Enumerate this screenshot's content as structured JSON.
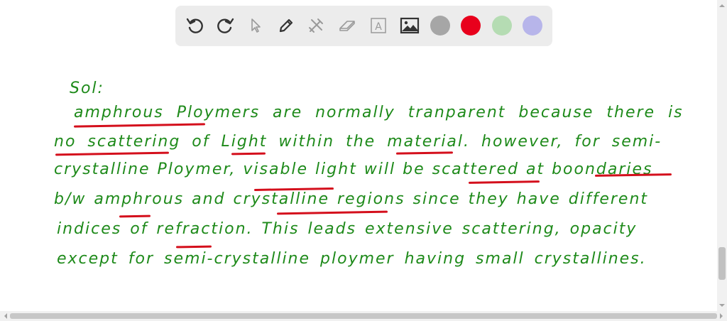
{
  "toolbar": {
    "tools": [
      {
        "name": "undo-icon"
      },
      {
        "name": "redo-icon"
      },
      {
        "name": "pointer-icon"
      },
      {
        "name": "pen-icon"
      },
      {
        "name": "tools-icon"
      },
      {
        "name": "eraser-icon"
      },
      {
        "name": "text-icon",
        "label": "A"
      },
      {
        "name": "image-icon"
      }
    ],
    "colors": [
      "#a6a6a6",
      "#e8001c",
      "#b5dcb3",
      "#b7b5ea"
    ]
  },
  "note": {
    "heading": "Sol:",
    "lines": [
      "amphrous Ploymers are normally tranparent because there is",
      "no scattering of Light within the material. however, for semi-",
      "crystalline Ploymer, visable light will be scattered at boondaries",
      "b/w amphrous and crystalline regions since they have different",
      "indices of refraction. This leads extensive scattering, opacity",
      "except for semi-crystalline ploymer having small crystallines."
    ],
    "ink_color": "#1e8a1a",
    "underline_color": "#d40f1c"
  }
}
